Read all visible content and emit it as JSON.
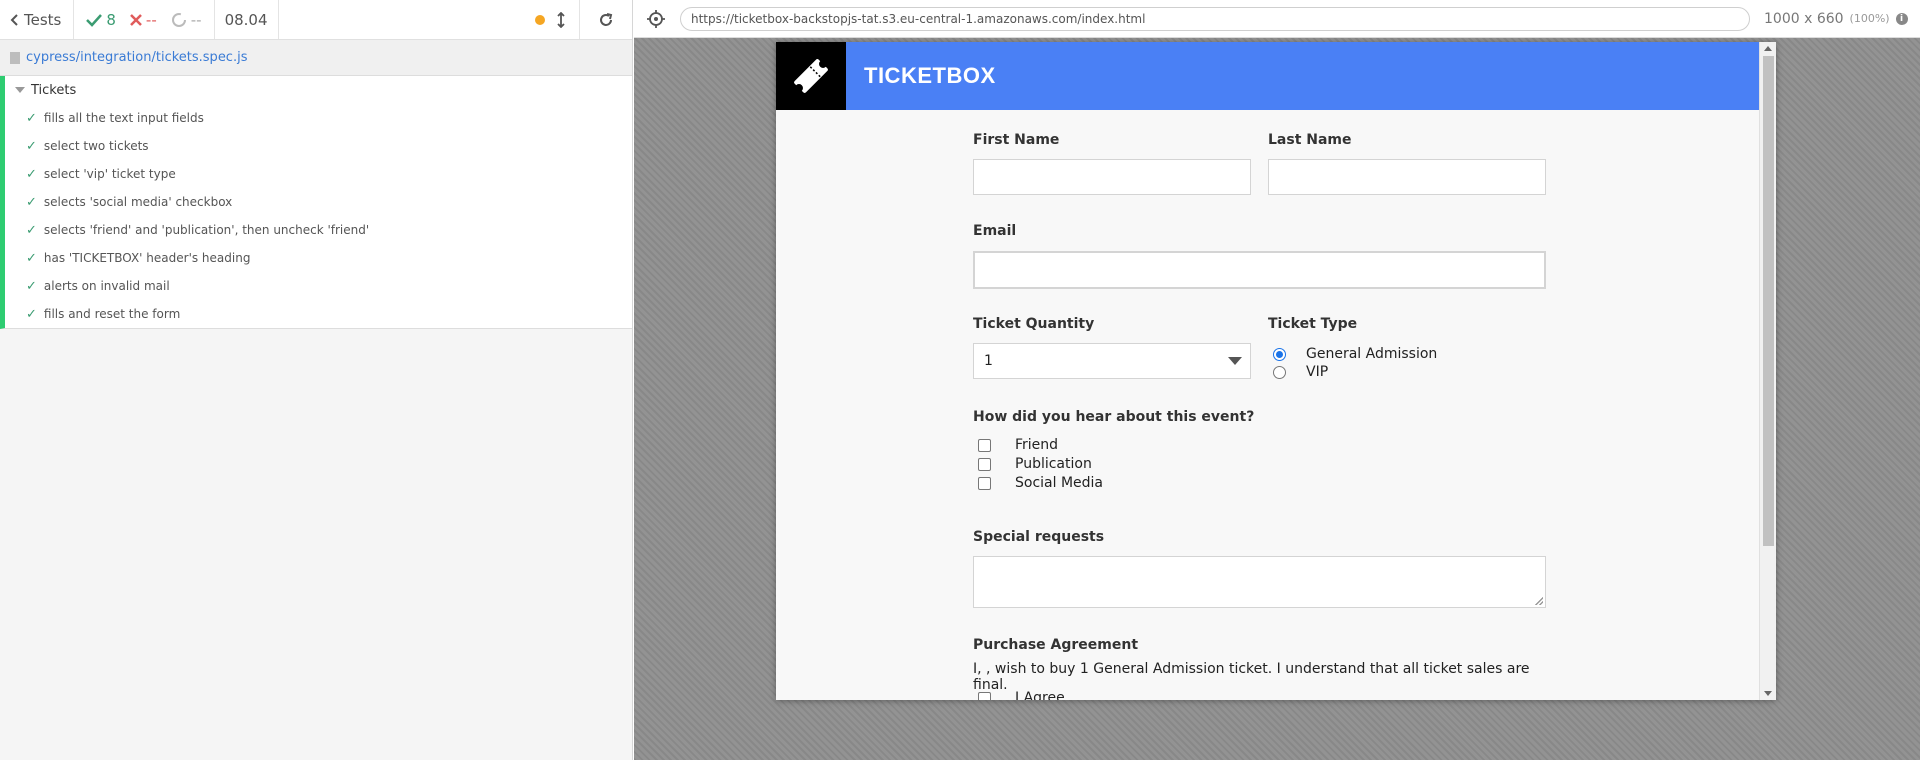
{
  "reporter": {
    "tests_label": "Tests",
    "passed": "8",
    "failed": "--",
    "pending": "--",
    "duration": "08.04",
    "spec_path": "cypress/integration/tickets.spec.js",
    "suite_title": "Tickets",
    "tests": [
      "fills all the text input fields",
      "select two tickets",
      "select 'vip' ticket type",
      "selects 'social media' checkbox",
      "selects 'friend' and 'publication', then uncheck 'friend'",
      "has 'TICKETBOX' header's heading",
      "alerts on invalid mail",
      "fills and reset the form"
    ]
  },
  "aut": {
    "url": "https://ticketbox-backstopjs-tat.s3.eu-central-1.amazonaws.com/index.html",
    "viewport": "1000 x 660",
    "scale": "(100%)"
  },
  "app": {
    "title": "TICKETBOX",
    "first_name_label": "First Name",
    "last_name_label": "Last Name",
    "email_label": "Email",
    "quantity_label": "Ticket Quantity",
    "quantity_value": "1",
    "ticket_type_label": "Ticket Type",
    "ticket_types": [
      "General Admission",
      "VIP"
    ],
    "hear_label": "How did you hear about this event?",
    "hear_options": [
      "Friend",
      "Publication",
      "Social Media"
    ],
    "special_label": "Special requests",
    "agreement_label": "Purchase Agreement",
    "agreement_text": "I, , wish to buy 1 General Admission ticket. I understand that all ticket sales are final.",
    "agree_label": "I Agree"
  },
  "colors": {
    "header_blue": "#4a80f5",
    "pass_green": "#3b9c72",
    "fail_red": "#e05b5b"
  }
}
